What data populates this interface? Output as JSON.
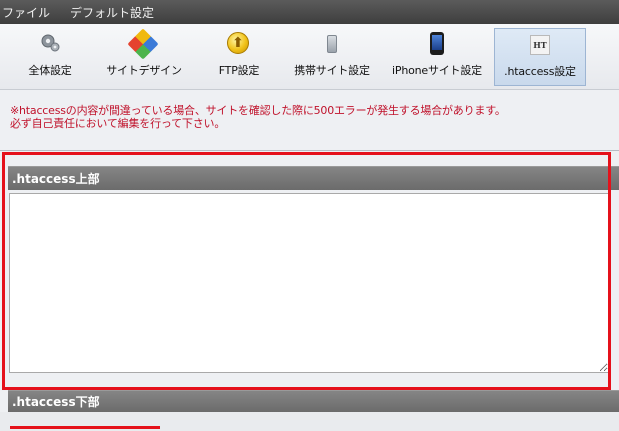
{
  "menubar": {
    "items": [
      "ファイル",
      "デフォルト設定"
    ]
  },
  "toolbar": {
    "items": [
      {
        "label": "全体設定",
        "icon": "gear-icon"
      },
      {
        "label": "サイトデザイン",
        "icon": "palette-icon"
      },
      {
        "label": "FTP設定",
        "icon": "ftp-coin-icon",
        "glyph": "⬆"
      },
      {
        "label": "携帯サイト設定",
        "icon": "mobile-phone-icon"
      },
      {
        "label": "iPhoneサイト設定",
        "icon": "iphone-icon"
      },
      {
        "label": ".htaccess設定",
        "icon": "htaccess-icon",
        "glyph": "HT",
        "active": true
      }
    ]
  },
  "warning": {
    "line1": "※htaccessの内容が間違っている場合、サイトを確認した際に500エラーが発生する場合があります。",
    "line2": "必ず自己責任において編集を行って下さい。"
  },
  "sections": {
    "top": {
      "title": ".htaccess上部",
      "value": ""
    },
    "bottom": {
      "title": ".htaccess下部"
    }
  },
  "colors": {
    "warning_text": "#c0122b",
    "highlight": "#e5111b",
    "section_header": "#7a7a7a",
    "menubar": "#4a4a4a"
  }
}
